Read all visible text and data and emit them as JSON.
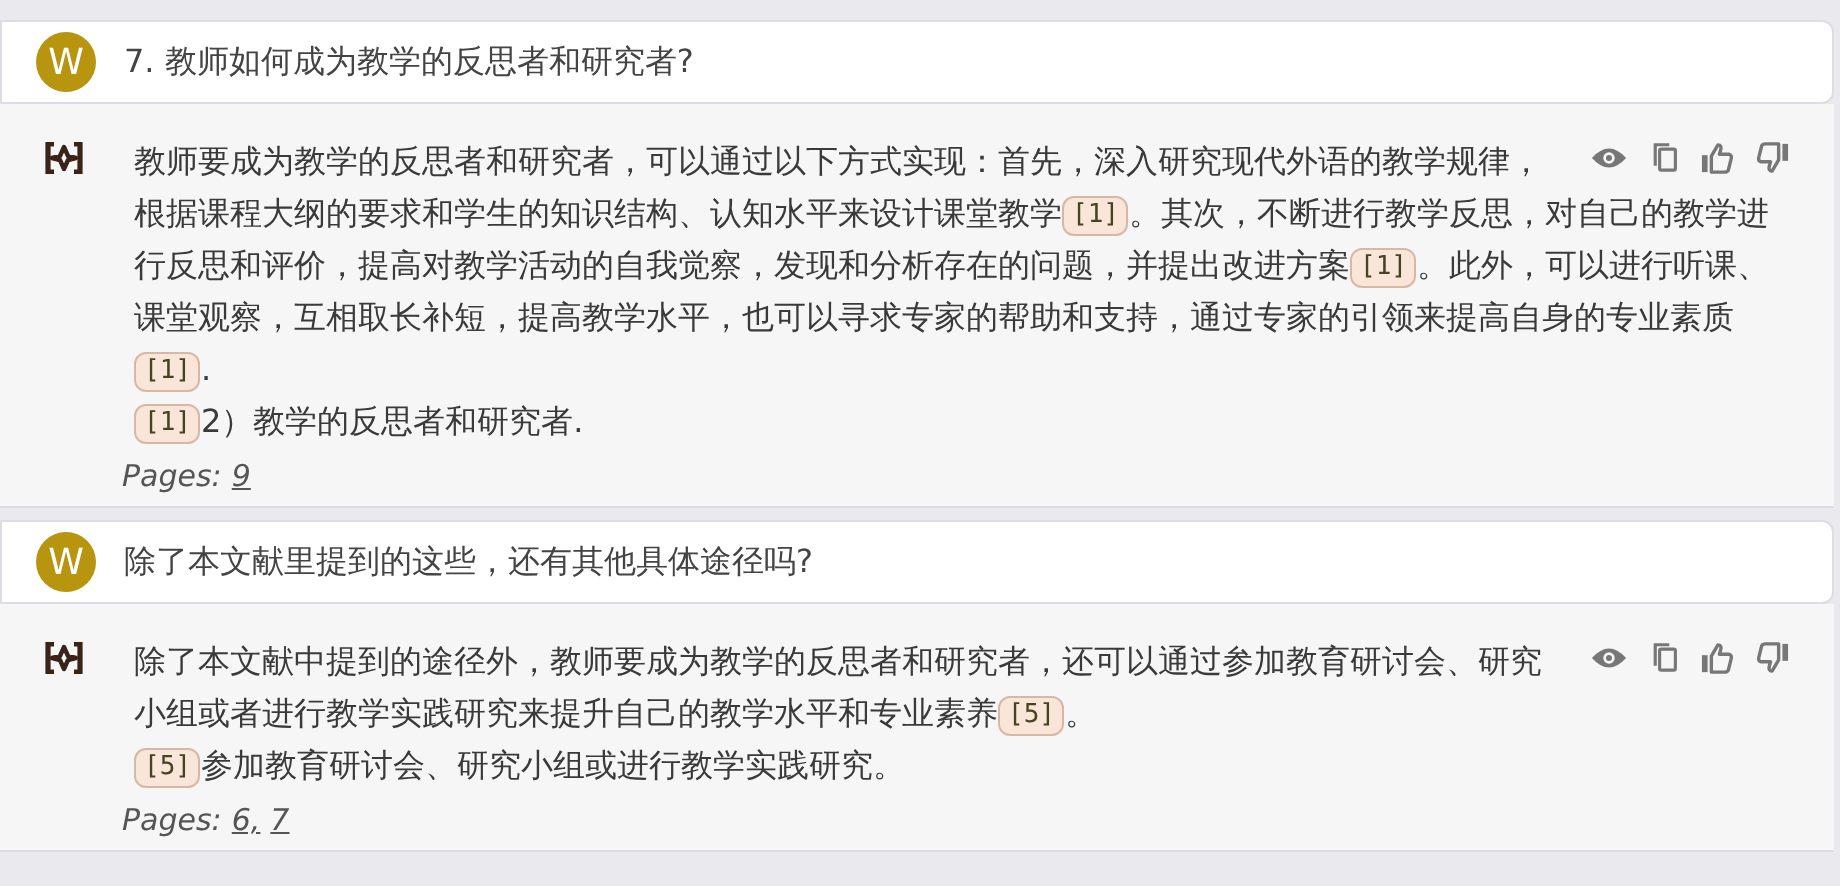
{
  "messages": [
    {
      "question": {
        "avatar": "W",
        "text": "7. 教师如何成为教学的反思者和研究者?"
      },
      "answer": {
        "paragraphs": [
          [
            {
              "kind": "text",
              "text": "教师要成为教学的反思者和研究者，可以通过以下方式实现：首先，深入研究现代外语的教学规律，根据课程大纲的要求和学生的知识结构、认知水平来设计课堂教学"
            },
            {
              "kind": "cite",
              "text": "[1]"
            },
            {
              "kind": "text",
              "text": "。其次，不断进行教学反思，对自己的教学进行反思和评价，提高对教学活动的自我觉察，发现和分析存在的问题，并提出改进方案"
            },
            {
              "kind": "cite",
              "text": "[1]"
            },
            {
              "kind": "text",
              "text": "。此外，可以进行听课、课堂观察，互相取长补短，提高教学水平，也可以寻求专家的帮助和支持，通过专家的引领来提高自身的专业素质"
            },
            {
              "kind": "cite",
              "text": "[1]"
            },
            {
              "kind": "text",
              "text": "."
            }
          ],
          [
            {
              "kind": "cite",
              "text": "[1]"
            },
            {
              "kind": "text",
              "text": "2）教学的反思者和研究者."
            }
          ]
        ],
        "pages_label": "Pages:",
        "pages": [
          "9"
        ]
      }
    },
    {
      "question": {
        "avatar": "W",
        "text": "除了本文献里提到的这些，还有其他具体途径吗?"
      },
      "answer": {
        "paragraphs": [
          [
            {
              "kind": "text",
              "text": "除了本文献中提到的途径外，教师要成为教学的反思者和研究者，还可以通过参加教育研讨会、研究小组或者进行教学实践研究来提升自己的教学水平和专业素养"
            },
            {
              "kind": "cite",
              "text": "[5]"
            },
            {
              "kind": "text",
              "text": "。"
            }
          ],
          [
            {
              "kind": "cite",
              "text": "[5]"
            },
            {
              "kind": "text",
              "text": "参加教育研讨会、研究小组或进行教学实践研究。"
            }
          ]
        ],
        "pages_label": "Pages:",
        "pages": [
          "6,",
          "7"
        ]
      }
    }
  ]
}
